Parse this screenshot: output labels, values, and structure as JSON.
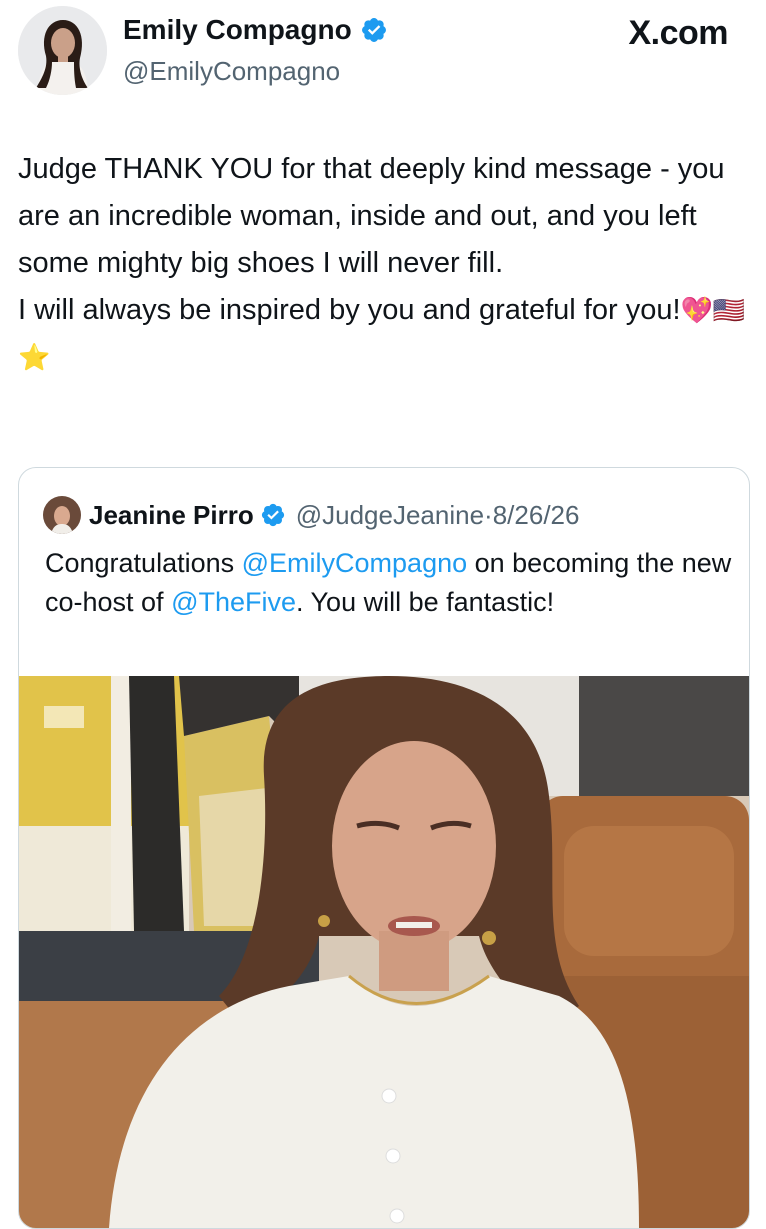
{
  "author": {
    "name": "Emily Compagno",
    "handle": "@EmilyCompagno",
    "verified": true
  },
  "source_label": "X.com",
  "tweet": {
    "line1": "Judge THANK YOU for that deeply kind message - you are an incredible woman, inside and out, and you left some mighty big shoes I will never fill.",
    "line2": "I will always be inspired by you and grateful for you!",
    "emojis": "💖🇺🇸⭐"
  },
  "quoted_tweet": {
    "name": "Jeanine Pirro",
    "handle": "@JudgeJeanine",
    "separator": " · ",
    "date": "8/26/26",
    "text_before": "Congratulations ",
    "mention1": "@EmilyCompagno",
    "text_middle": " on becoming the new co-host of ",
    "mention2": "@TheFive",
    "text_after": ". You will be fantastic!"
  },
  "colors": {
    "verified_blue": "#1d9bf0",
    "link": "#1d9bf0",
    "secondary_text": "#536471",
    "border": "#cfd9de"
  }
}
